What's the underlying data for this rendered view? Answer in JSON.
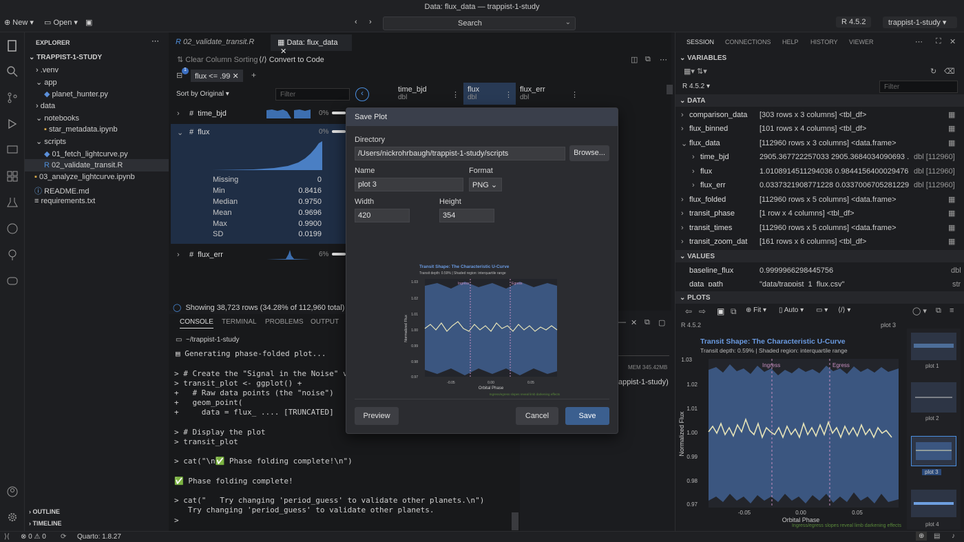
{
  "window": {
    "title": "Data: flux_data — trappist-1-study"
  },
  "toolbar": {
    "new": "New",
    "open": "Open",
    "search": "Search",
    "r_version": "R 4.5.2",
    "project": "trappist-1-study"
  },
  "explorer": {
    "header": "EXPLORER",
    "root": "TRAPPIST-1-STUDY",
    "items": [
      ".venv",
      "app",
      "planet_hunter.py",
      "data",
      "notebooks",
      "star_metadata.ipynb",
      "scripts",
      "01_fetch_lightcurve.py",
      "02_validate_transit.R",
      "03_analyze_lightcurve.ipynb",
      "README.md",
      "requirements.txt"
    ],
    "outline": "OUTLINE",
    "timeline": "TIMELINE"
  },
  "editor": {
    "tabs": [
      "02_validate_transit.R",
      "Data: flux_data"
    ],
    "clear_sort": "Clear Column Sorting",
    "convert": "Convert to Code",
    "filter_chip": "flux <= .99",
    "sort_label": "Sort by Original",
    "filter_placeholder": "Filter",
    "columns": [
      {
        "name": "time_bjd",
        "type": "dbl"
      },
      {
        "name": "flux",
        "type": "dbl"
      },
      {
        "name": "flux_err",
        "type": "dbl"
      }
    ],
    "vars": [
      {
        "name": "time_bjd",
        "pct": "0%"
      },
      {
        "name": "flux",
        "pct": "0%"
      },
      {
        "name": "flux_err",
        "pct": "6%"
      }
    ],
    "stats": [
      {
        "label": "Missing",
        "value": "0"
      },
      {
        "label": "Min",
        "value": "0.8416"
      },
      {
        "label": "Median",
        "value": "0.9750"
      },
      {
        "label": "Mean",
        "value": "0.9696"
      },
      {
        "label": "Max",
        "value": "0.9900"
      },
      {
        "label": "SD",
        "value": "0.0199"
      }
    ],
    "showing": "Showing 38,723 rows (34.28% of 112,960 total)",
    "mem": "MEM 345.42MB",
    "right_text": "appist-1-study)"
  },
  "panel": {
    "tabs": [
      "CONSOLE",
      "TERMINAL",
      "PROBLEMS",
      "OUTPUT"
    ],
    "cwd": "~/trappist-1-study",
    "lines": [
      "Generating phase-folded plot...",
      "",
      "> # Create the \"Signal in the Noise\" visuali",
      "> transit_plot <- ggplot() +",
      "+   # Raw data points (the \"noise\")",
      "+   geom_point(",
      "+     data = flux_ .... [TRUNCATED]",
      "",
      "> # Display the plot",
      "> transit_plot",
      "",
      "> cat(\"\\n✅ Phase folding complete!\\n\")",
      "",
      "✅ Phase folding complete!",
      "",
      "> cat(\"   Try changing 'period_guess' to validate other planets.\\n\")",
      "   Try changing 'period_guess' to validate other planets.",
      "",
      ">"
    ]
  },
  "dialog": {
    "title": "Save Plot",
    "directory_label": "Directory",
    "directory": "/Users/nickrohrbaugh/trappist-1-study/scripts",
    "browse": "Browse...",
    "name_label": "Name",
    "name": "plot 3",
    "format_label": "Format",
    "format": "PNG",
    "width_label": "Width",
    "width": "420",
    "height_label": "Height",
    "height": "354",
    "preview": "Preview",
    "cancel": "Cancel",
    "save": "Save"
  },
  "plot": {
    "title": "Transit Shape: The Characteristic U-Curve",
    "subtitle": "Transit depth: 0.59% | Shaded region: interquartile range",
    "ylabel": "Normalized Flux",
    "xlabel": "Orbital Phase",
    "ingress": "Ingress",
    "egress": "Egress",
    "caption": "Ingress/egress slopes reveal limb darkening effects",
    "yticks": [
      "1.03",
      "1.02",
      "1.01",
      "1.00",
      "0.99",
      "0.98",
      "0.97"
    ],
    "xticks": [
      "-0.05",
      "0.00",
      "0.05"
    ]
  },
  "session": {
    "tabs": [
      "SESSION",
      "CONNECTIONS",
      "HELP",
      "HISTORY",
      "VIEWER"
    ],
    "variables": "VARIABLES",
    "r": "R 4.5.2",
    "filter": "Filter",
    "data": "DATA",
    "values": "VALUES",
    "plots": "PLOTS",
    "rows": [
      {
        "name": "comparison_data",
        "value": "[303 rows x 3 columns] <tbl_df>",
        "type": ""
      },
      {
        "name": "flux_binned",
        "value": "[101 rows x 4 columns] <tbl_df>",
        "type": ""
      },
      {
        "name": "flux_data",
        "value": "[112960 rows x 3 columns] <data.frame>",
        "type": ""
      },
      {
        "name": "time_bjd",
        "value": "2905.367722257033 2905.3684034090693 ...",
        "type": "dbl [112960]"
      },
      {
        "name": "flux",
        "value": "1.0108914511294036 0.9844156400029476 ...",
        "type": "dbl [112960]"
      },
      {
        "name": "flux_err",
        "value": "0.0337321908771228 0.0337006705281229...",
        "type": "dbl [112960]"
      },
      {
        "name": "flux_folded",
        "value": "[112960 rows x 5 columns] <data.frame>",
        "type": ""
      },
      {
        "name": "transit_phase",
        "value": "[1 row x 4 columns] <tbl_df>",
        "type": ""
      },
      {
        "name": "transit_times",
        "value": "[112960 rows x 5 columns] <data.frame>",
        "type": ""
      },
      {
        "name": "transit_zoom_dat",
        "value": "[161 rows x 6 columns] <tbl_df>",
        "type": ""
      }
    ],
    "vals": [
      {
        "name": "baseline_flux",
        "value": "0.9999966298445756",
        "type": "dbl"
      },
      {
        "name": "data_path",
        "value": "\"data/trappist_1_flux.csv\"",
        "type": "str"
      }
    ],
    "fit": "Fit",
    "auto": "Auto",
    "plot_r": "R 4.5.2",
    "plot_name": "plot 3",
    "thumbs": [
      "plot 1",
      "plot 2",
      "plot 3",
      "plot 4"
    ]
  },
  "status": {
    "errors": "0",
    "warnings": "0",
    "quarto": "Quarto: 1.8.27"
  }
}
